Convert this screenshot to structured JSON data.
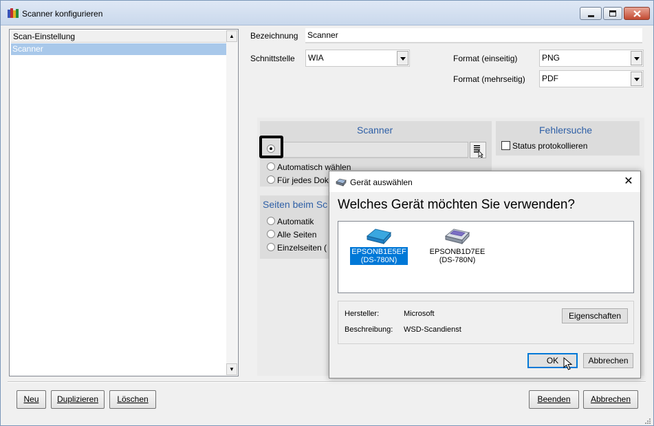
{
  "window": {
    "title": "Scanner konfigurieren"
  },
  "list": {
    "header": "Scan-Einstellung",
    "items": [
      "Scanner"
    ]
  },
  "form": {
    "bezeichnung_label": "Bezeichnung",
    "bezeichnung_value": "Scanner",
    "schnittstelle_label": "Schnittstelle",
    "schnittstelle_value": "WIA",
    "format_single_label": "Format (einseitig)",
    "format_single_value": "PNG",
    "format_multi_label": "Format (mehrseitig)",
    "format_multi_value": "PDF"
  },
  "scanner_panel": {
    "title": "Scanner",
    "device_value": "",
    "options": [
      "Automatisch wählen",
      "Für jedes Dok"
    ]
  },
  "fehlersuche_panel": {
    "title": "Fehlersuche",
    "checkbox_label": "Status protokollieren"
  },
  "seiten_panel": {
    "title": "Seiten beim Sc",
    "options": [
      "Automatik",
      "Alle Seiten",
      "Einzelseiten ("
    ]
  },
  "buttons": {
    "neu": "Neu",
    "duplizieren": "Duplizieren",
    "loeschen": "Löschen",
    "beenden": "Beenden",
    "abbrechen": "Abbrechen"
  },
  "dialog": {
    "title": "Gerät auswählen",
    "question": "Welches Gerät möchten Sie verwenden?",
    "devices": [
      {
        "line1": "EPSONB1E5EF",
        "line2": "(DS-780N)"
      },
      {
        "line1": "EPSONB1D7EE",
        "line2": "(DS-780N)"
      }
    ],
    "hersteller_label": "Hersteller:",
    "hersteller_value": "Microsoft",
    "beschreibung_label": "Beschreibung:",
    "beschreibung_value": "WSD-Scandienst",
    "eigenschaften": "Eigenschaften",
    "ok": "OK",
    "abbrechen": "Abbrechen",
    "close_glyph": "✕"
  },
  "colors": {
    "accent_blue": "#2e5fa6",
    "selection": "#0078d7",
    "list_selection": "#a8c8ea"
  }
}
